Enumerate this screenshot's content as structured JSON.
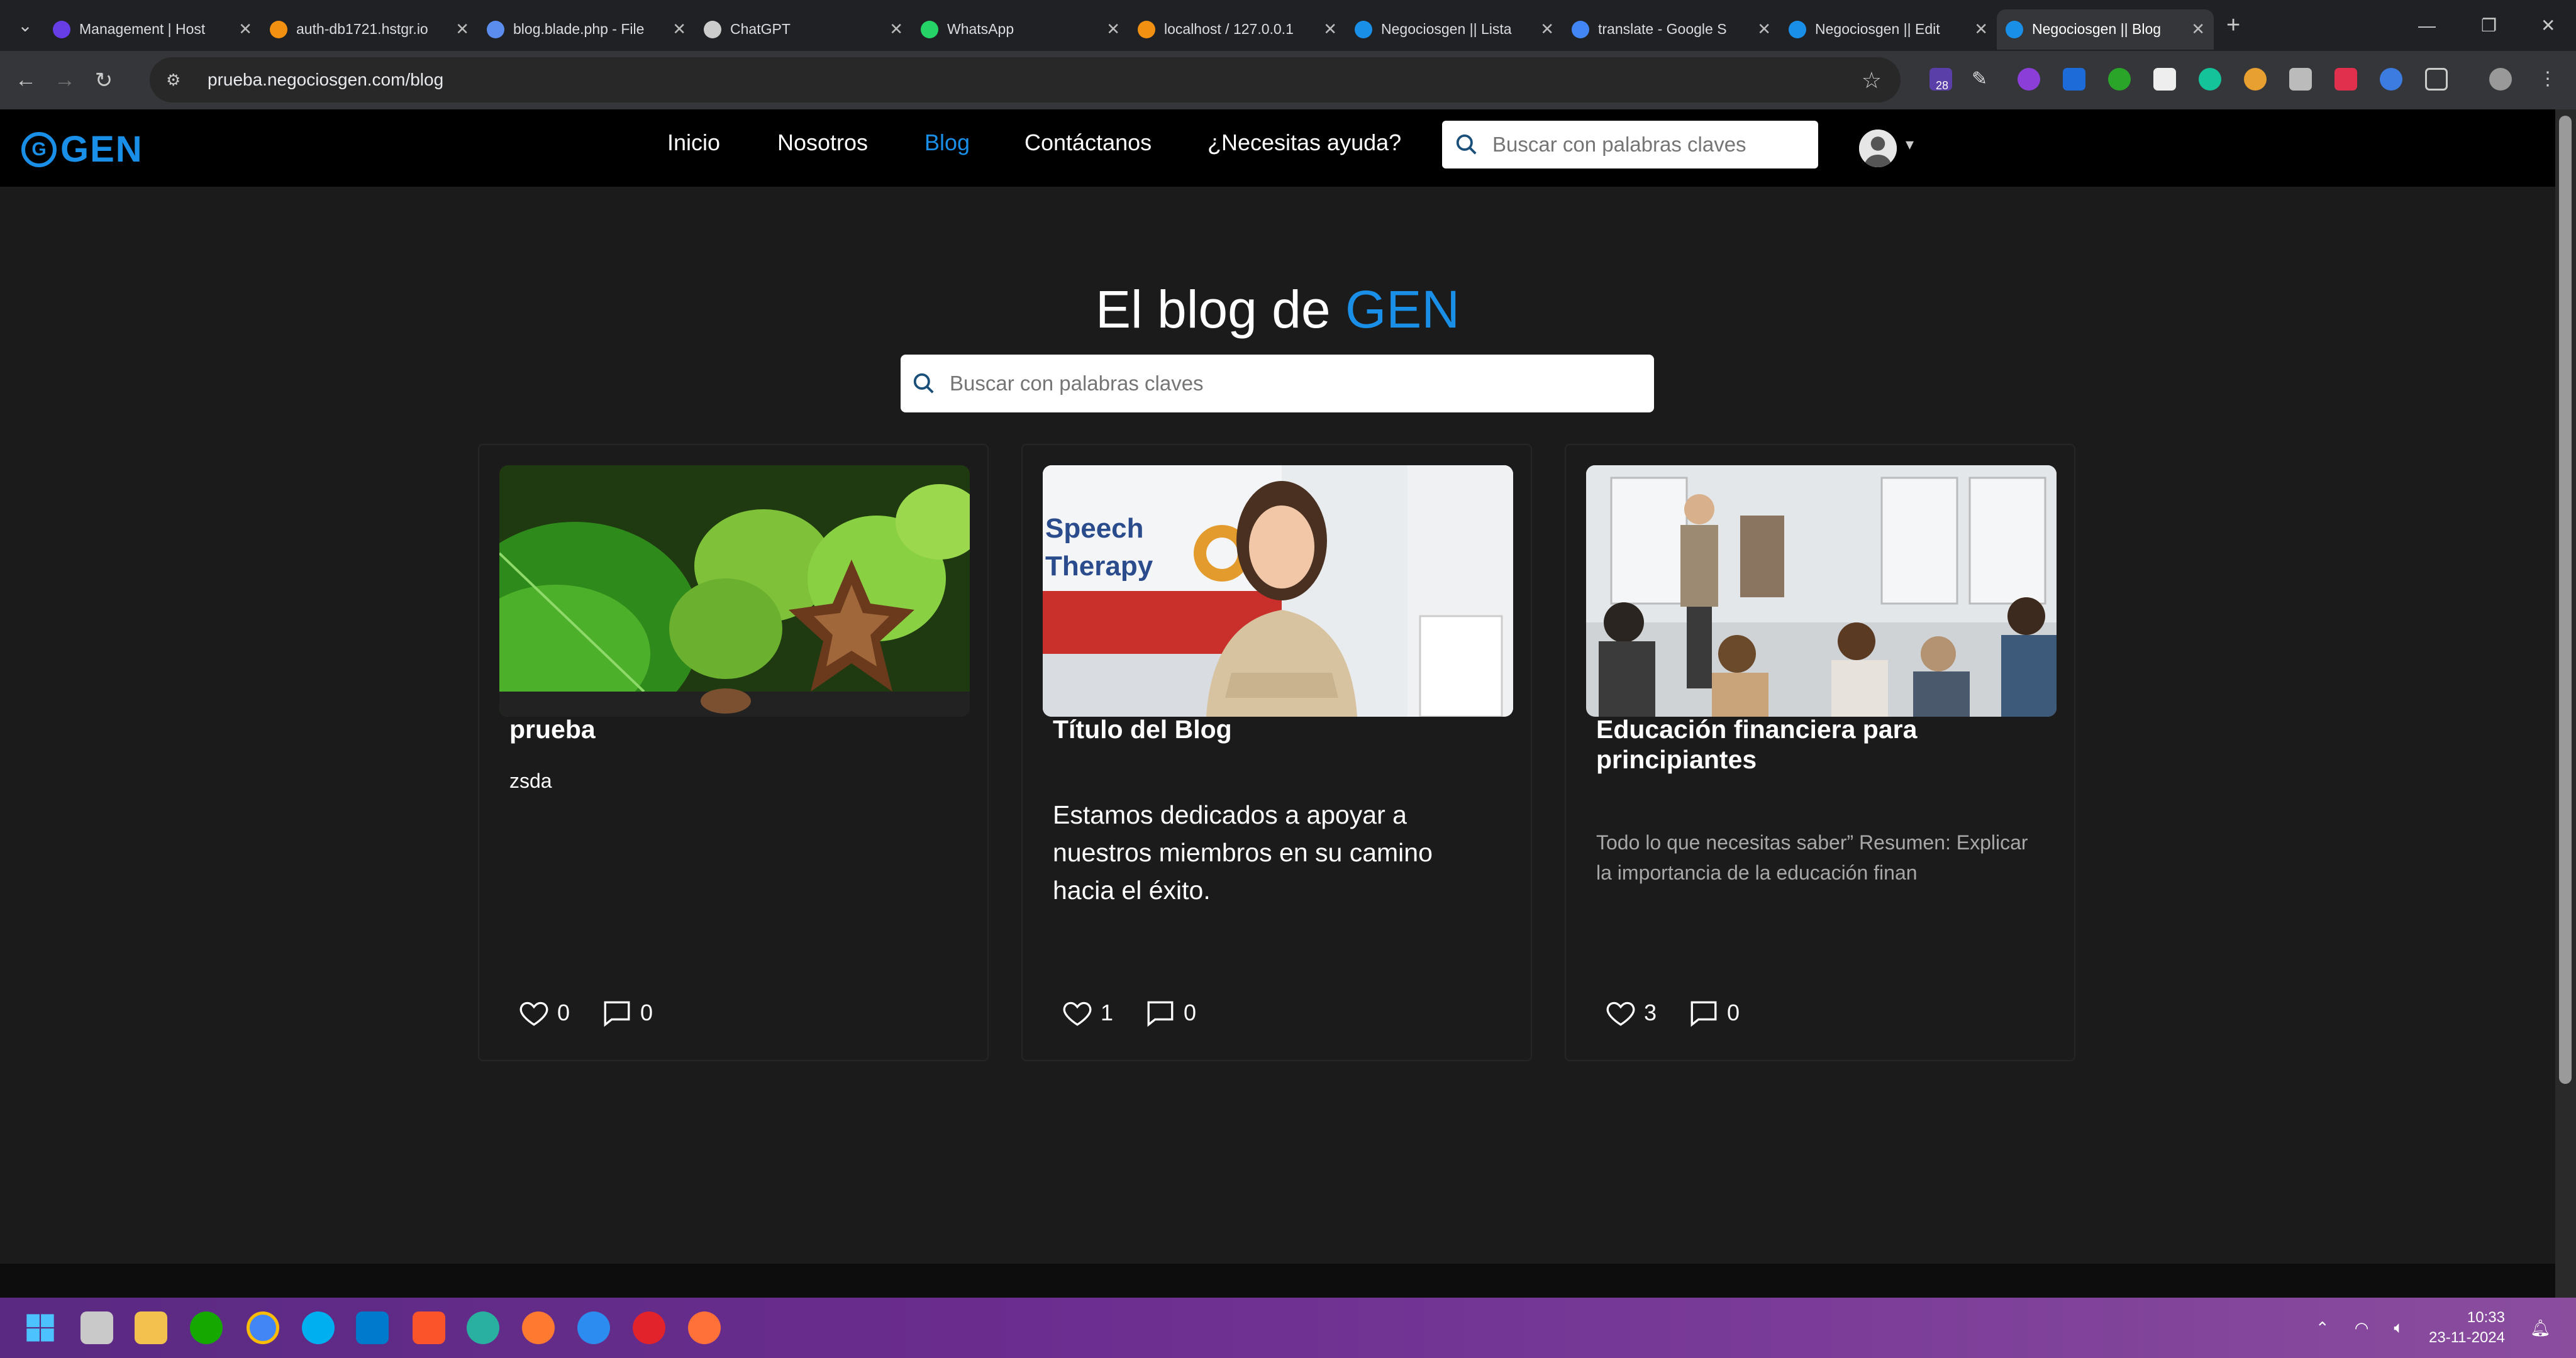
{
  "browser": {
    "tabs": [
      {
        "title": "Management | Host",
        "color": "#673de6"
      },
      {
        "title": "auth-db1721.hstgr.io",
        "color": "#f29111"
      },
      {
        "title": "blog.blade.php - File",
        "color": "#5b8def"
      },
      {
        "title": "ChatGPT",
        "color": "#cccccc"
      },
      {
        "title": "WhatsApp",
        "color": "#25d366"
      },
      {
        "title": "localhost / 127.0.0.1",
        "color": "#f29111"
      },
      {
        "title": "Negociosgen || Lista",
        "color": "#1a8fe8"
      },
      {
        "title": "translate - Google S",
        "color": "#4285f4"
      },
      {
        "title": "Negociosgen || Edit",
        "color": "#1a8fe8"
      },
      {
        "title": "Negociosgen || Blog",
        "color": "#1a8fe8"
      }
    ],
    "active_tab_index": 9,
    "url": "prueba.negociosgen.com/blog",
    "extension_badge": "28"
  },
  "site": {
    "logo_text": "GEN",
    "logo_letter": "G",
    "nav": [
      "Inicio",
      "Nosotros",
      "Blog",
      "Contáctanos",
      "¿Necesitas ayuda?"
    ],
    "active_nav": "Blog",
    "nav_search_placeholder": "Buscar con palabras claves",
    "heading_prefix": "El blog de",
    "heading_accent": "GEN",
    "search_placeholder": "Buscar con palabras claves",
    "accent_color": "#1a8fe8"
  },
  "posts": [
    {
      "title": "prueba",
      "excerpt": "zsda",
      "likes": "0",
      "comments": "0",
      "image": "sacha-inchi-fruit"
    },
    {
      "title": "Título del Blog",
      "excerpt": "Estamos dedicados a apoyar a nuestros miembros en su camino hacia el éxito.",
      "likes": "1",
      "comments": "0",
      "image": "speech-therapy-woman",
      "image_text_line1": "Speech",
      "image_text_line2": "Therapy"
    },
    {
      "title": "Educación financiera para principiantes",
      "excerpt": "Todo lo que necesitas saber” Resumen: Explicar la importancia de la educación finan",
      "likes": "3",
      "comments": "0",
      "image": "classroom-presentation"
    }
  ],
  "taskbar": {
    "time": "10:33",
    "date": "23-11-2024"
  }
}
